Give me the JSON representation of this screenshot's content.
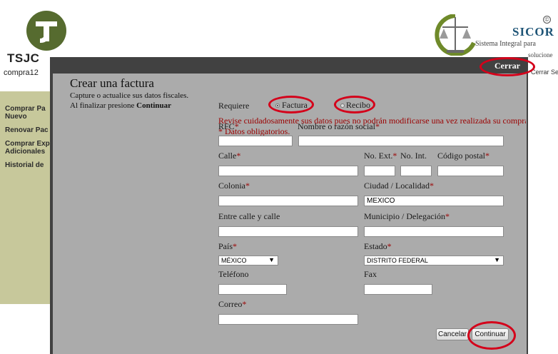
{
  "background": {
    "brand_left": "TSJC",
    "user_label": "compra12",
    "menu": [
      "Comprar Pa Nuevo",
      "Renovar Pac",
      "Comprar Exp Adicionales",
      "Historial de"
    ],
    "brand_right_title": "SICOR",
    "brand_right_subtitle": "Sistema Integral para",
    "brand_right_subtitle2": "solucione",
    "close_session": "Cerrar Se"
  },
  "dialog": {
    "close_label": "Cerrar",
    "title": "Crear una factura",
    "subtitle_line1": "Capture o actualice sus datos fiscales.",
    "subtitle_line2_prefix": "Al finalizar presione",
    "subtitle_line2_bold": "Continuar",
    "requires_label": "Requiere",
    "option_invoice": "Factura",
    "option_receipt": "Recibo",
    "warning": "Revise cuidadosamente sus datos pues no podrán modificarse una vez realizada su compra",
    "required_note": "* Datos obligatorios.",
    "fields": {
      "rfc": {
        "label": "RFC",
        "value": ""
      },
      "name": {
        "label": "Nombre o razón social",
        "value": ""
      },
      "street": {
        "label": "Calle",
        "value": ""
      },
      "ext_no": {
        "label": "No. Ext.",
        "value": ""
      },
      "int_no": {
        "label": "No. Int.",
        "value": ""
      },
      "zip": {
        "label": "Código postal",
        "value": ""
      },
      "colony": {
        "label": "Colonia",
        "value": ""
      },
      "city": {
        "label": "Ciudad / Localidad",
        "value": "MEXICO"
      },
      "between": {
        "label": "Entre calle y calle",
        "value": ""
      },
      "municipality": {
        "label": "Municipio / Delegación",
        "value": ""
      },
      "country": {
        "label": "País",
        "value": "MÉXICO"
      },
      "state": {
        "label": "Estado",
        "value": "DISTRITO FEDERAL"
      },
      "phone": {
        "label": "Teléfono",
        "value": ""
      },
      "fax": {
        "label": "Fax",
        "value": ""
      },
      "email": {
        "label": "Correo",
        "value": ""
      }
    },
    "required_mark": "*",
    "cancel_label": "Cancelar",
    "continue_label": "Continuar"
  },
  "colors": {
    "highlight_ring": "#d4001a",
    "required": "#9b0000",
    "modal_frame": "#414141",
    "modal_body": "#ababab"
  }
}
